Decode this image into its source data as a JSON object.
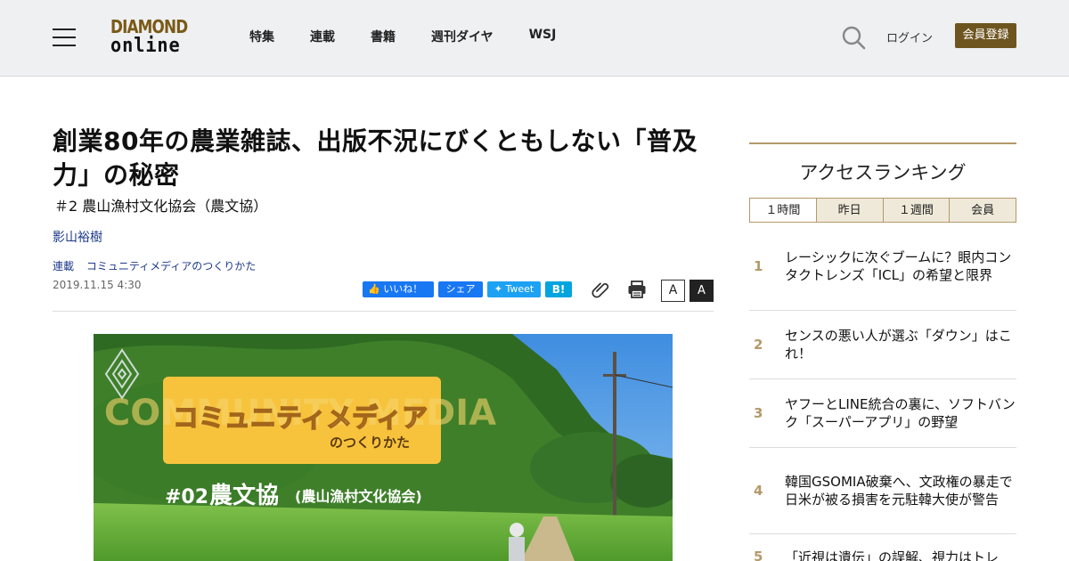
{
  "header": {
    "logo_top": "DIAMOND",
    "logo_bottom": "online",
    "nav": [
      "特集",
      "連載",
      "書籍",
      "週刊ダイヤ",
      "WSJ"
    ],
    "login": "ログイン",
    "register": "会員登録"
  },
  "article": {
    "title": "創業80年の農業雑誌、出版不況にびくともしない「普及力」の秘密",
    "subtitle": "＃2 農山漁村文化協会（農文協）",
    "author": "影山裕樹",
    "tags": [
      "連載",
      "コミュニティメディアのつくりかた"
    ],
    "date": "2019.11.15 4:30"
  },
  "share": {
    "like": "いいね！",
    "share": "シェア",
    "tweet": "Tweet",
    "hatena": "B!",
    "font_small": "A",
    "font_large": "A"
  },
  "hero": {
    "banner_main": "コミュニティメディア",
    "banner_sub": "のつくりかた",
    "banner_bg": "COMMUNITY MEDIA",
    "episode": "#02",
    "episode_title": "農文協",
    "episode_paren": "(農山漁村文化協会)"
  },
  "sidebar": {
    "title": "アクセスランキング",
    "tabs": [
      "１時間",
      "昨日",
      "１週間",
      "会員"
    ],
    "items": [
      {
        "rank": "1",
        "text": "レーシックに次ぐブームに？眼内コンタクトレンズ「ICL」の希望と限界"
      },
      {
        "rank": "2",
        "text": "センスの悪い人が選ぶ「ダウン」はこれ！"
      },
      {
        "rank": "3",
        "text": "ヤフーとLINE統合の裏に、ソフトバンク「スーパーアプリ」の野望"
      },
      {
        "rank": "4",
        "text": "韓国GSOMIA破棄へ、文政権の暴走で日米が被る損害を元駐韓大使が警告"
      },
      {
        "rank": "5",
        "text": "「近視は遺伝」の誤解、視力はトレ"
      }
    ]
  },
  "colors": {
    "brand_gold": "#7a5a17",
    "register_bg": "#6e5520",
    "link_blue": "#1e3b8a",
    "rank_gold": "#b4996a"
  }
}
